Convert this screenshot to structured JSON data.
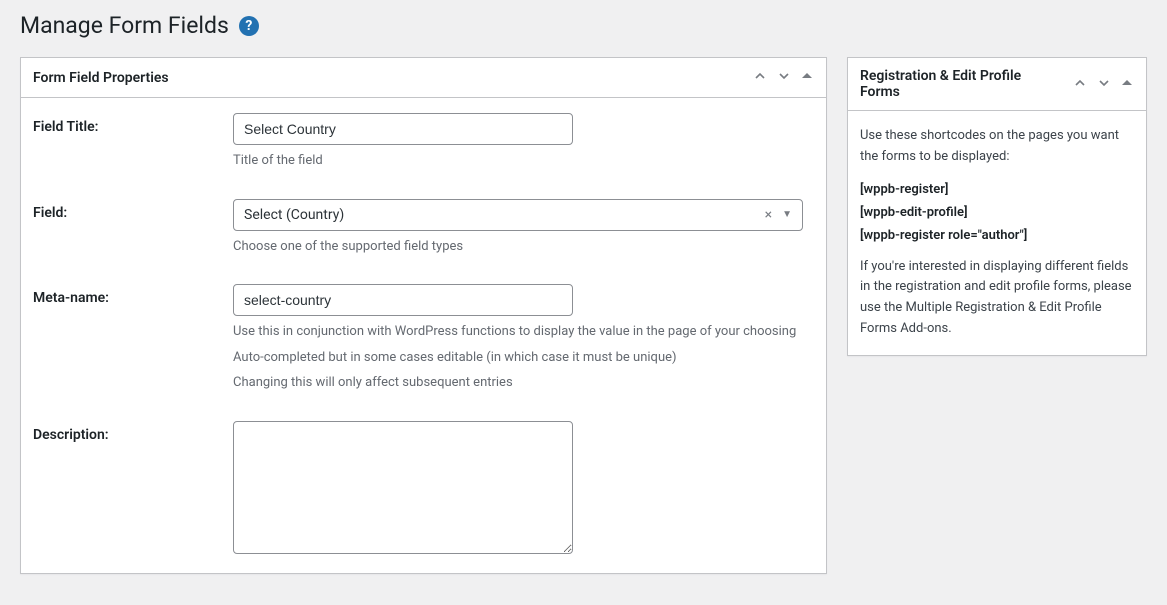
{
  "pageTitle": "Manage Form Fields",
  "mainPanel": {
    "title": "Form Field Properties",
    "rows": {
      "fieldTitle": {
        "label": "Field Title:",
        "value": "Select Country",
        "help": "Title of the field"
      },
      "field": {
        "label": "Field:",
        "value": "Select (Country)",
        "help": "Choose one of the supported field types"
      },
      "metaName": {
        "label": "Meta-name:",
        "value": "select-country",
        "help1": "Use this in conjunction with WordPress functions to display the value in the page of your choosing",
        "help2": "Auto-completed but in some cases editable (in which case it must be unique)",
        "help3": "Changing this will only affect subsequent entries"
      },
      "description": {
        "label": "Description:",
        "value": ""
      }
    }
  },
  "sidePanel": {
    "title": "Registration & Edit Profile Forms",
    "intro": "Use these shortcodes on the pages you want the forms to be displayed:",
    "shortcodes": [
      "[wppb-register]",
      "[wppb-edit-profile]",
      "[wppb-register role=\"author\"]"
    ],
    "footnote": "If you're interested in displaying different fields in the registration and edit profile forms, please use the Multiple Registration & Edit Profile Forms Add-ons."
  }
}
